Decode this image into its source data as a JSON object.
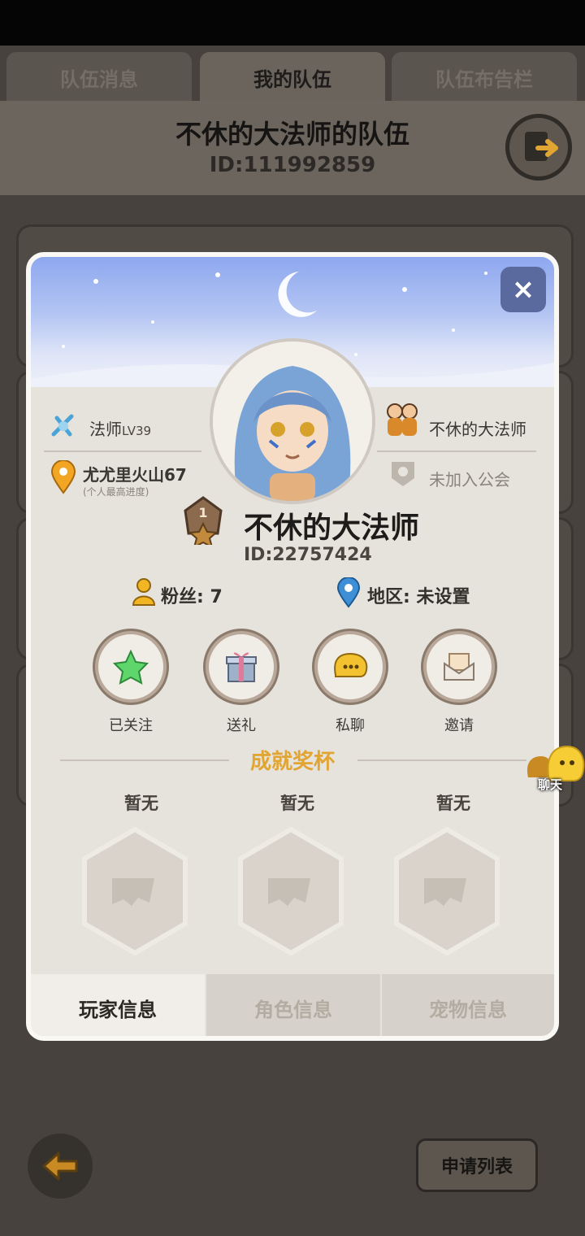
{
  "tabs": [
    {
      "label": "队伍消息",
      "active": false
    },
    {
      "label": "我的队伍",
      "active": true
    },
    {
      "label": "队伍布告栏",
      "active": false
    }
  ],
  "team": {
    "title": "不休的大法师的队伍",
    "id": "ID:111992859"
  },
  "bottom_buttons": {
    "apply_list": "申请列表"
  },
  "profile": {
    "class_label": "法师",
    "class_level": "LV39",
    "progress_location": "尤尤里火山67",
    "progress_note": "(个人最高进度)",
    "team_leader": "不休的大法师",
    "guild_status": "未加入公会",
    "player_name": "不休的大法师",
    "rank_number": "1",
    "player_id": "ID:22757424",
    "fans_label": "粉丝: 7",
    "region_label": "地区: 未设置",
    "actions": [
      {
        "label": "已关注",
        "icon": "star-icon"
      },
      {
        "label": "送礼",
        "icon": "gift-icon"
      },
      {
        "label": "私聊",
        "icon": "chat-bubble-icon"
      },
      {
        "label": "邀请",
        "icon": "invite-envelope-icon"
      }
    ],
    "trophy_section_title": "成就奖杯",
    "trophies": [
      {
        "label": "暂无"
      },
      {
        "label": "暂无"
      },
      {
        "label": "暂无"
      }
    ],
    "bottom_tabs": [
      {
        "label": "玩家信息",
        "active": true
      },
      {
        "label": "角色信息",
        "active": false
      },
      {
        "label": "宠物信息",
        "active": false
      }
    ]
  },
  "floating_chat": {
    "label": "聊天"
  },
  "colors": {
    "accent_gold": "#e1a534",
    "dialog_bg": "#e6e2dc",
    "close_button": "#5b6a9e",
    "location_pin": "#f2a623",
    "region_pin": "#3f8fd6"
  }
}
